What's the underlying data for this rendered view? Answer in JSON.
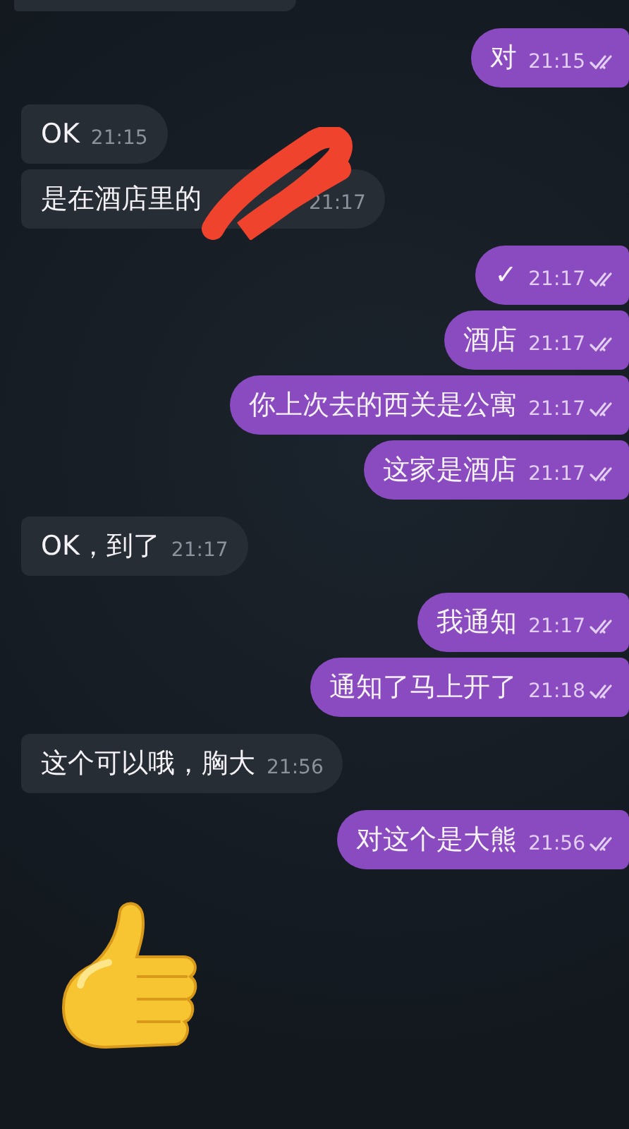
{
  "messages": [
    {
      "kind": "partial"
    },
    {
      "kind": "outgoing",
      "text": "对",
      "time": "21:15",
      "read": true
    },
    {
      "kind": "incoming",
      "text": "OK",
      "time": "21:15"
    },
    {
      "kind": "incoming",
      "text": "是在酒店里的",
      "time": "21:17",
      "redacted": true
    },
    {
      "kind": "outgoing",
      "text": "✓",
      "time": "21:17",
      "read": true
    },
    {
      "kind": "outgoing",
      "text": "酒店",
      "time": "21:17",
      "read": true
    },
    {
      "kind": "outgoing",
      "text": "你上次去的西关是公寓",
      "time": "21:17",
      "read": true
    },
    {
      "kind": "outgoing",
      "text": "这家是酒店",
      "time": "21:17",
      "read": true
    },
    {
      "kind": "incoming",
      "text": "OK，到了",
      "time": "21:17"
    },
    {
      "kind": "outgoing",
      "text": "我通知",
      "time": "21:17",
      "read": true
    },
    {
      "kind": "outgoing",
      "text": "通知了马上开了",
      "time": "21:18",
      "read": true
    },
    {
      "kind": "incoming",
      "text": "这个可以哦，胸大",
      "time": "21:56"
    },
    {
      "kind": "outgoing",
      "text": "对这个是大熊",
      "time": "21:56",
      "read": true
    },
    {
      "kind": "sticker"
    }
  ]
}
